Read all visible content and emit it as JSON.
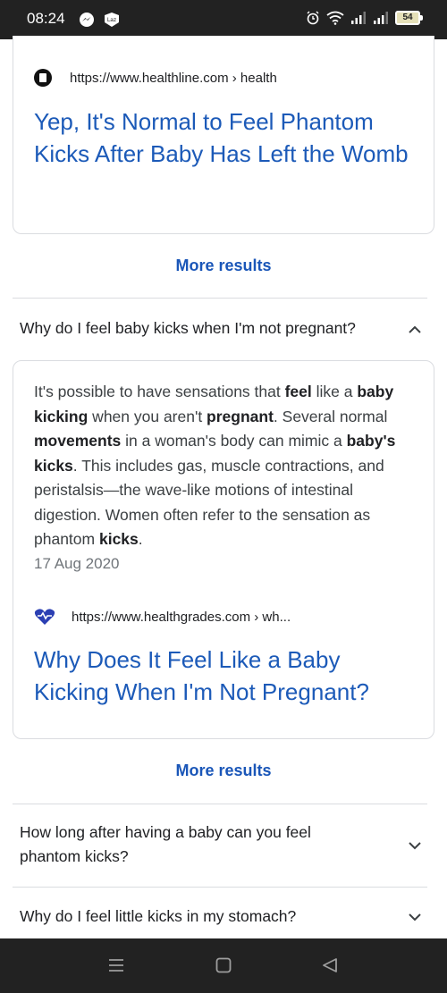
{
  "status": {
    "time": "08:24",
    "battery": "54",
    "left_icons": [
      "messenger-icon",
      "lazada-icon"
    ],
    "right_icons": [
      "alarm-icon",
      "wifi-icon",
      "signal-icon",
      "signal-icon-2",
      "battery-icon"
    ]
  },
  "result_top": {
    "url": "https://www.healthline.com › health",
    "title": "Yep, It's Normal to Feel Phantom Kicks After Baby Has Left the Womb"
  },
  "more_results_1": "More results",
  "faq_1": {
    "question": "Why do I feel baby kicks when I'm not pregnant?",
    "answer": {
      "s1": "It's possible to have sensations that ",
      "b1": "feel",
      "s2": " like a ",
      "b2": "baby kicking",
      "s3": " when you aren't ",
      "b3": "pregnant",
      "s4": ". Several normal ",
      "b4": "movements",
      "s5": " in a woman's body can mimic a ",
      "b5": "baby's kicks",
      "s6": ". This includes gas, muscle contractions, and peristalsis—the wave-like motions of intestinal digestion. Women often refer to the sensation as phantom ",
      "b6": "kicks",
      "s7": "."
    },
    "date": "17 Aug 2020",
    "source_url": "https://www.healthgrades.com › wh...",
    "source_title": "Why Does It Feel Like a Baby Kicking When I'm Not Pregnant?"
  },
  "more_results_2": "More results",
  "faq_2": {
    "question": "How long after having a baby can you feel phantom kicks?"
  },
  "faq_3": {
    "question": "Why do I feel little kicks in my stomach?"
  },
  "nav": [
    "menu-icon",
    "home-icon",
    "back-icon"
  ]
}
